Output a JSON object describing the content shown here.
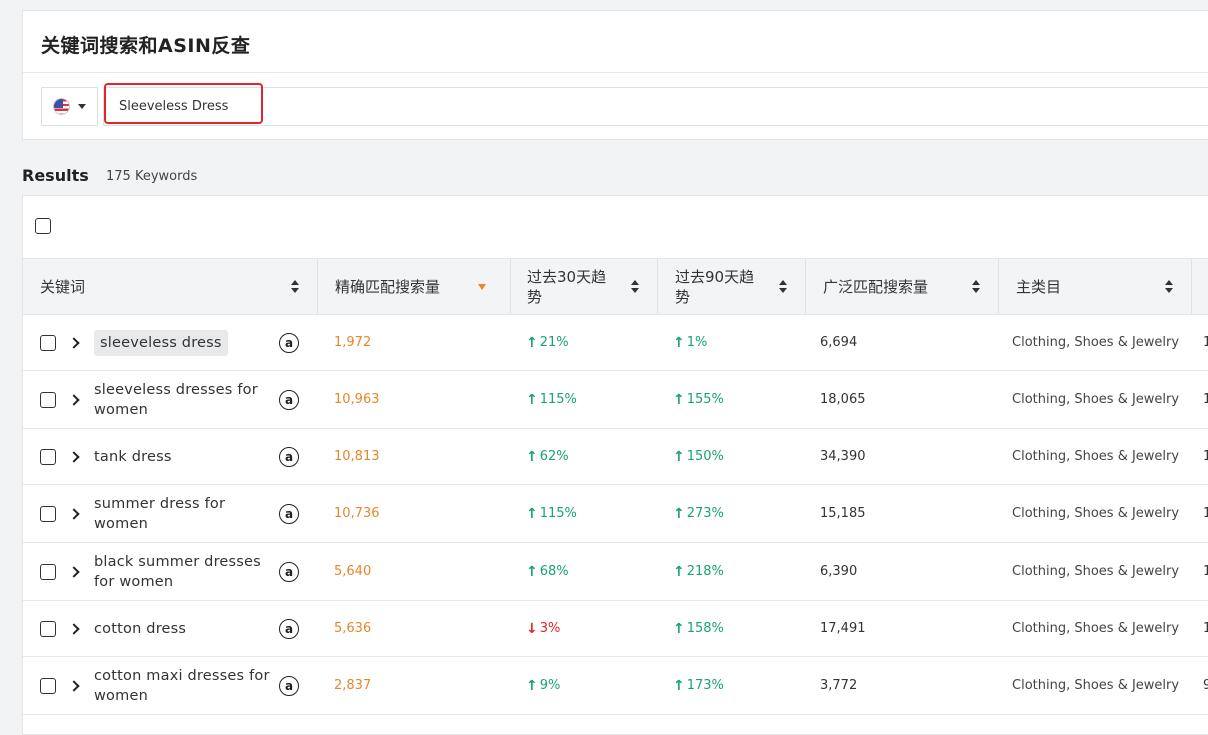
{
  "header": {
    "title": "关键词搜索和ASIN反查",
    "country_icon": "us-flag-icon",
    "search_value": "Sleeveless Dress"
  },
  "results": {
    "label": "Results",
    "count": "175 Keywords"
  },
  "columns": [
    {
      "label": "关键词"
    },
    {
      "label": "精确匹配搜索量"
    },
    {
      "label": "过去30天趋势"
    },
    {
      "label": "过去90天趋势"
    },
    {
      "label": "广泛匹配搜索量"
    },
    {
      "label": "主类目"
    }
  ],
  "colors": {
    "exact": "#e8862a",
    "trend_up": "#1aa36f",
    "trend_down": "#e0262a",
    "highlight": "#e0262a"
  },
  "rows": [
    {
      "keyword": "sleeveless dress",
      "exact": "1,972",
      "t30": "21%",
      "t30_dir": "up",
      "t90": "1%",
      "t90_dir": "up",
      "broad": "6,694",
      "category": "Clothing, Shoes & Jewelry",
      "last": "1"
    },
    {
      "keyword": "sleeveless dresses for women",
      "exact": "10,963",
      "t30": "115%",
      "t30_dir": "up",
      "t90": "155%",
      "t90_dir": "up",
      "broad": "18,065",
      "category": "Clothing, Shoes & Jewelry",
      "last": "1"
    },
    {
      "keyword": "tank dress",
      "exact": "10,813",
      "t30": "62%",
      "t30_dir": "up",
      "t90": "150%",
      "t90_dir": "up",
      "broad": "34,390",
      "category": "Clothing, Shoes & Jewelry",
      "last": "1"
    },
    {
      "keyword": "summer dress for women",
      "exact": "10,736",
      "t30": "115%",
      "t30_dir": "up",
      "t90": "273%",
      "t90_dir": "up",
      "broad": "15,185",
      "category": "Clothing, Shoes & Jewelry",
      "last": "1"
    },
    {
      "keyword": "black summer dresses for women",
      "exact": "5,640",
      "t30": "68%",
      "t30_dir": "up",
      "t90": "218%",
      "t90_dir": "up",
      "broad": "6,390",
      "category": "Clothing, Shoes & Jewelry",
      "last": "1"
    },
    {
      "keyword": "cotton dress",
      "exact": "5,636",
      "t30": "3%",
      "t30_dir": "down",
      "t90": "158%",
      "t90_dir": "up",
      "broad": "17,491",
      "category": "Clothing, Shoes & Jewelry",
      "last": "1"
    },
    {
      "keyword": "cotton maxi dresses for women",
      "exact": "2,837",
      "t30": "9%",
      "t30_dir": "up",
      "t90": "173%",
      "t90_dir": "up",
      "broad": "3,772",
      "category": "Clothing, Shoes & Jewelry",
      "last": "9"
    }
  ]
}
